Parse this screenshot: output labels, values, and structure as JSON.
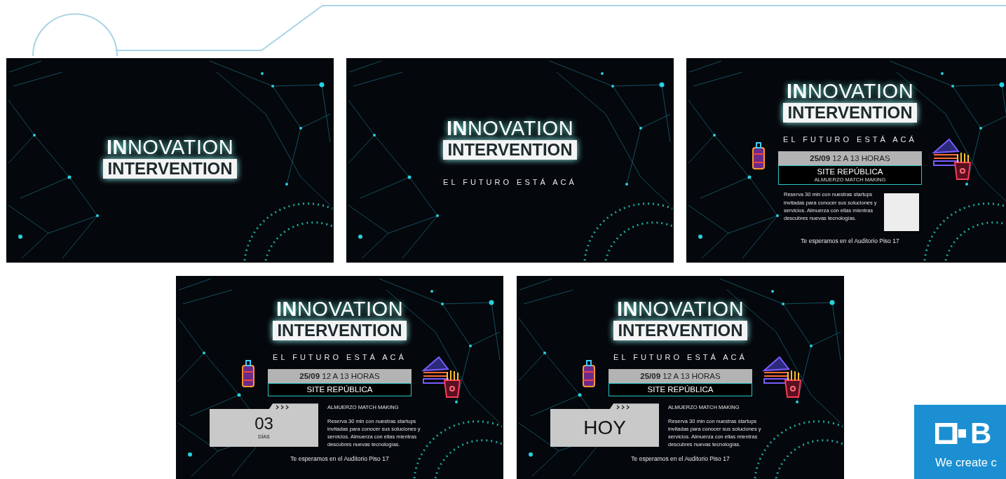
{
  "slides": [
    {
      "kind": "title",
      "logo": {
        "line1": "**IN**NOVATION",
        "line2": "INTERVENTION"
      }
    },
    {
      "kind": "tagline",
      "logo": {
        "line1": "**IN**NOVATION",
        "line2": "INTERVENTION"
      },
      "tagline": "EL FUTURO ESTÁ ACÁ"
    },
    {
      "kind": "detail",
      "logo": {
        "line1": "**IN**NOVATION",
        "line2": "INTERVENTION"
      },
      "tagline": "EL FUTURO ESTÁ ACÁ",
      "date": "**25/09** 12 A 13 HORAS",
      "site": "SITE REPÚBLICA",
      "subtitle": "ALMUERZO MATCH MAKING",
      "description": "Reserva 30 min con nuestras startups invitadas para conocer sus soluciones y servicios. Almuerza con ellas mientras descubres nuevas tecnologías.",
      "footer": "Te esperamos en el Auditorio Piso 17"
    },
    {
      "kind": "countdown",
      "logo": {
        "line1": "**IN**NOVATION",
        "line2": "INTERVENTION"
      },
      "tagline": "EL FUTURO ESTÁ ACÁ",
      "date": "**25/09** 12 A 13 HORAS",
      "site": "SITE REPÚBLICA",
      "countdown": {
        "value": "03",
        "unit": "DÍAS"
      },
      "heading": "ALMUERZO MATCH MAKING",
      "description": "Reserva 30 min con nuestras startups invitadas para conocer sus soluciones y servicios. Almuerza con ellas mientras descubres nuevas tecnologías.",
      "footer": "Te esperamos en el Auditorio Piso 17"
    },
    {
      "kind": "countdown",
      "logo": {
        "line1": "**IN**NOVATION",
        "line2": "INTERVENTION"
      },
      "tagline": "EL FUTURO ESTÁ ACÁ",
      "date": "**25/09** 12 A 13 HORAS",
      "site": "SITE REPÚBLICA",
      "countdown": {
        "value": "HOY"
      },
      "heading": "ALMUERZO MATCH MAKING",
      "description": "Reserva 30 min con nuestras startups invitadas para conocer sus soluciones y servicios. Almuerza con ellas mientras descubres nuevas tecnologías.",
      "footer": "Te esperamos en el Auditorio Piso 17"
    }
  ],
  "brand": {
    "name": "B",
    "tagline": "We create c"
  }
}
